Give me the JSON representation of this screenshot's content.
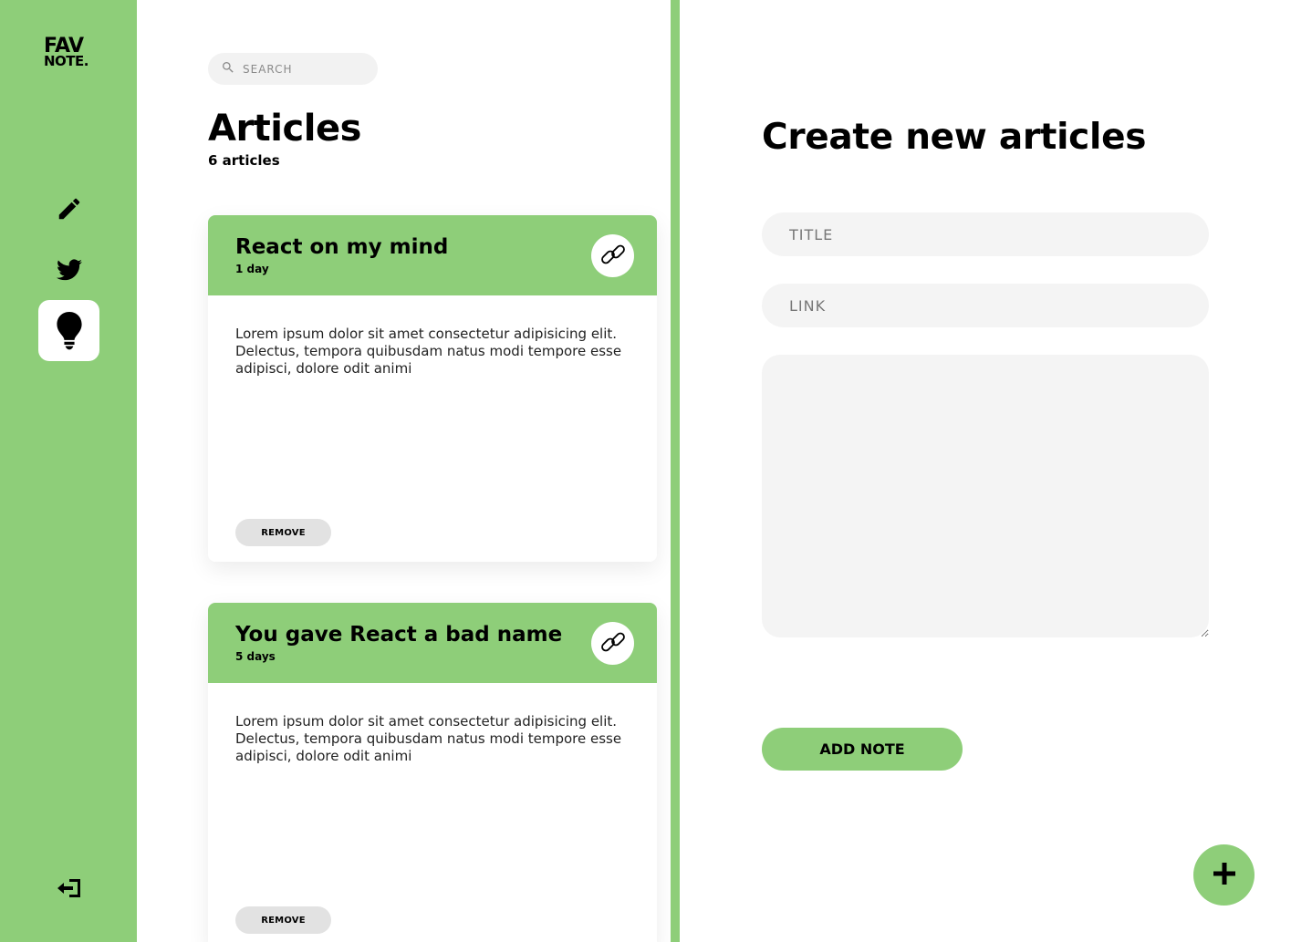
{
  "brand": {
    "line1": "FAV",
    "line2": "NOTE."
  },
  "sidebar": {
    "items": [
      {
        "name": "notes",
        "icon": "pencil-icon",
        "active": false
      },
      {
        "name": "twitters",
        "icon": "twitter-icon",
        "active": false
      },
      {
        "name": "articles",
        "icon": "lightbulb-icon",
        "active": true
      }
    ],
    "logout_icon": "logout-icon"
  },
  "search": {
    "placeholder": "SEARCH"
  },
  "page": {
    "title": "Articles",
    "count": "6 articles"
  },
  "cards": [
    {
      "title": "React on my mind",
      "date": "1 day",
      "content": "Lorem ipsum dolor sit amet consectetur adipisicing elit. Delectus, tempora quibusdam natus modi tempore esse adipisci, dolore odit animi",
      "remove_label": "REMOVE"
    },
    {
      "title": "You gave React a bad name",
      "date": "5 days",
      "content": "Lorem ipsum dolor sit amet consectetur adipisicing elit. Delectus, tempora quibusdam natus modi tempore esse adipisci, dolore odit animi",
      "remove_label": "REMOVE"
    }
  ],
  "panel": {
    "title": "Create new articles",
    "title_placeholder": "TITLE",
    "link_placeholder": "LINK",
    "submit_label": "ADD NOTE"
  },
  "colors": {
    "accent": "#8ece79",
    "field_bg": "#f4f4f4",
    "remove_bg": "#e2e2e2"
  }
}
